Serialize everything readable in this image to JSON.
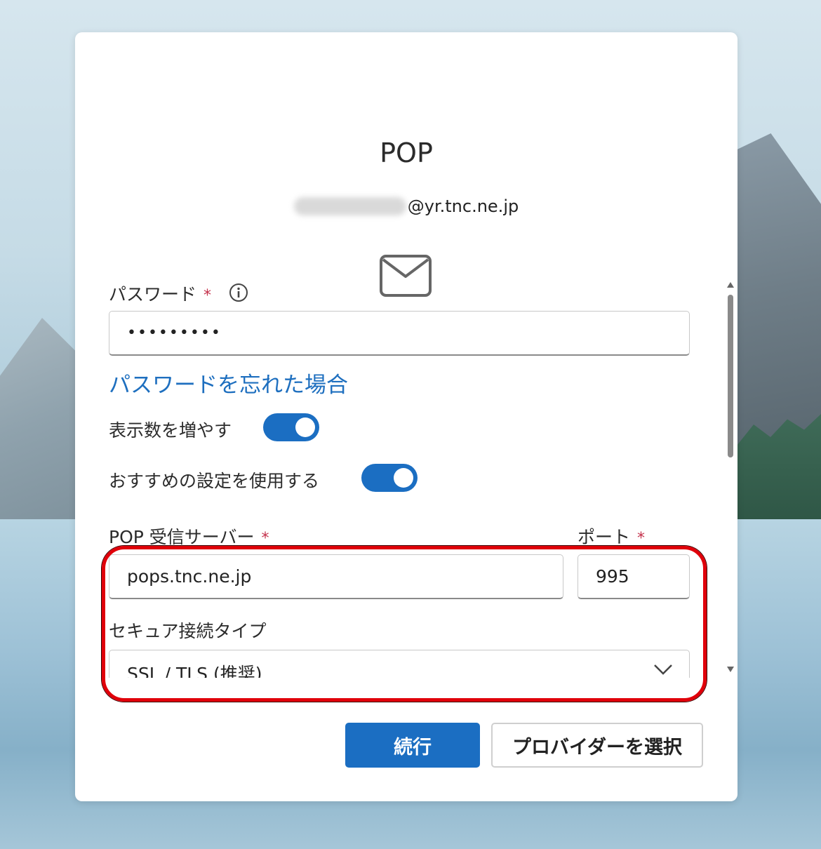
{
  "dialog": {
    "title": "POP",
    "email_domain": "@yr.tnc.ne.jp"
  },
  "password": {
    "label": "パスワード",
    "required_mark": "*",
    "value": "•••••••••",
    "forgot_link": "パスワードを忘れた場合"
  },
  "toggles": {
    "show_more_label": "表示数を増やす",
    "show_more_on": true,
    "recommended_label": "おすすめの設定を使用する",
    "recommended_on": true
  },
  "server": {
    "incoming_label": "POP 受信サーバー",
    "incoming_required": "*",
    "incoming_value": "pops.tnc.ne.jp",
    "port_label": "ポート",
    "port_required": "*",
    "port_value": "995",
    "secure_label": "セキュア接続タイプ",
    "secure_value": "SSL / TLS (推奨)"
  },
  "buttons": {
    "continue_label": "続行",
    "choose_provider_label": "プロバイダーを選択"
  },
  "icons": {
    "mail": "mail-icon",
    "info": "info-icon",
    "chevron": "chevron-down-icon"
  },
  "colors": {
    "accent": "#1b6ec2",
    "link": "#1e6fbf",
    "required": "#c4314b",
    "highlight": "#e0000a"
  }
}
